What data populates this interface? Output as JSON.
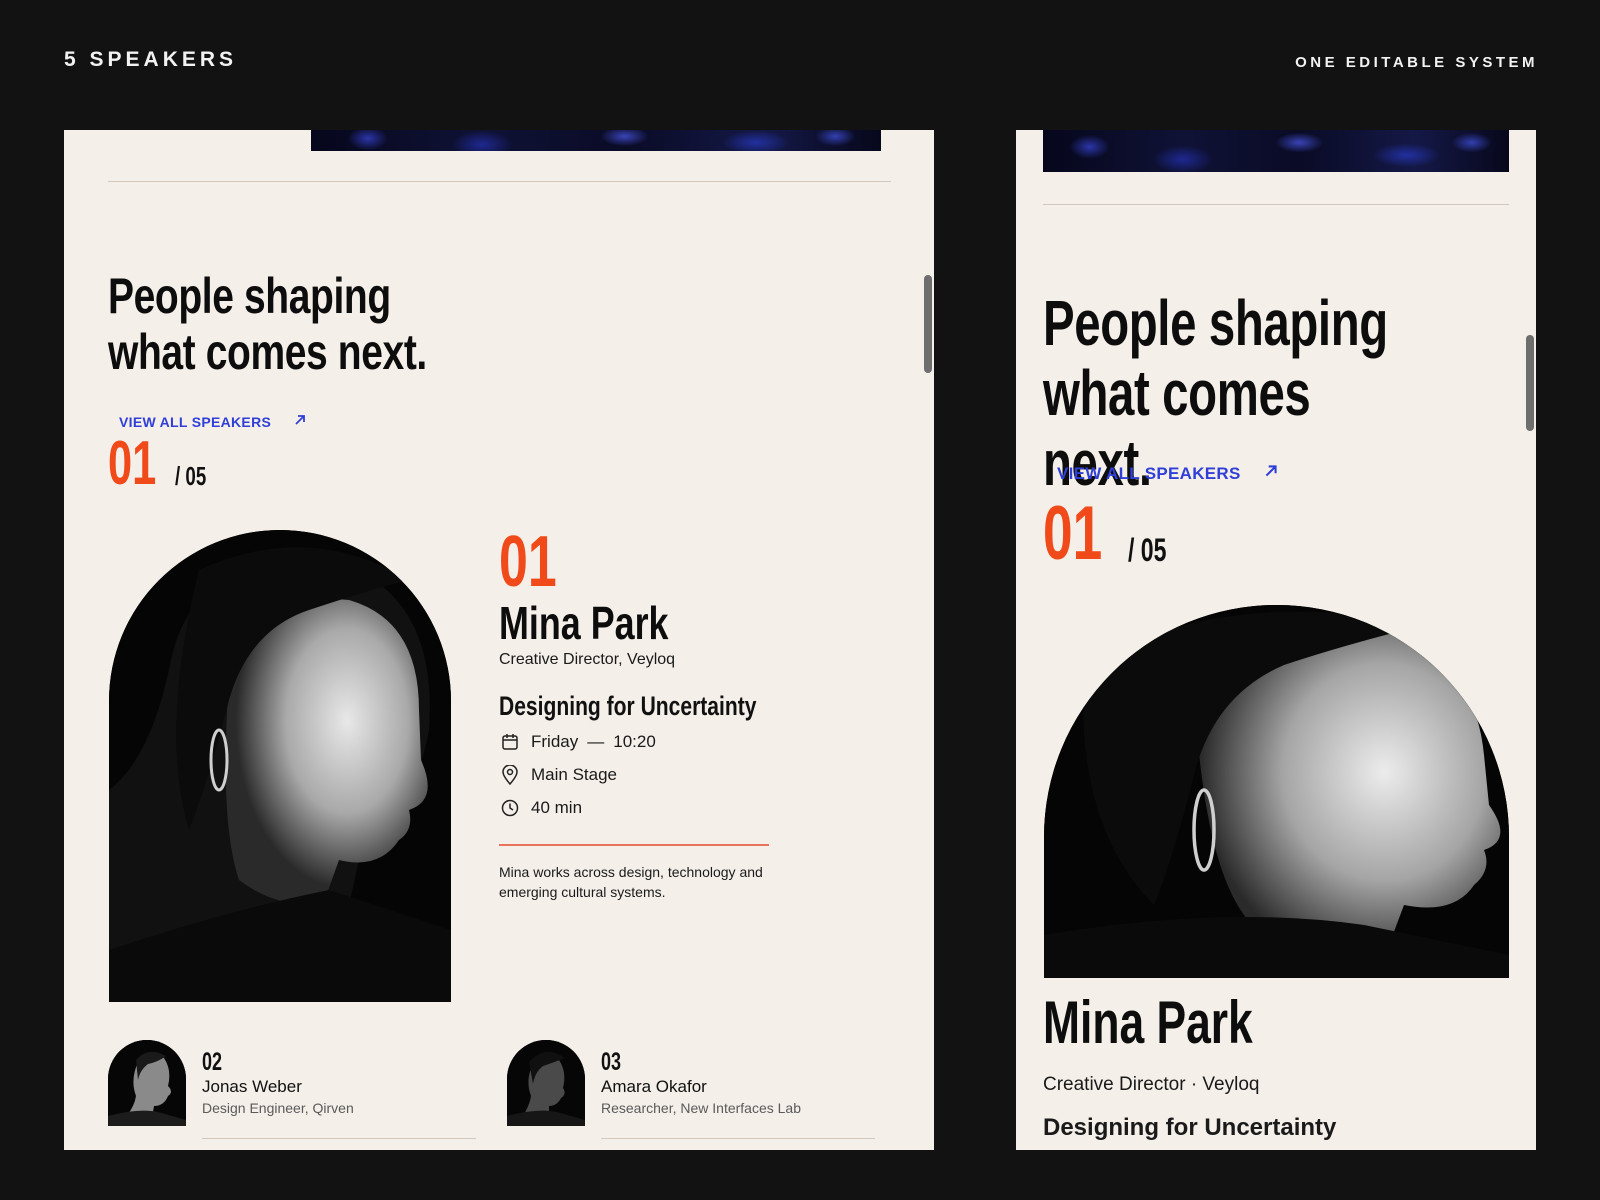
{
  "header": {
    "left_label": "5 SPEAKERS",
    "right_label": "ONE EDITABLE SYSTEM"
  },
  "section": {
    "headline": "People shaping\nwhat comes next.",
    "view_all_label": "VIEW ALL SPEAKERS",
    "view_all_icon": "arrow-up-right-icon",
    "accent_color": "#f04a1a",
    "link_color": "#2f3fd8"
  },
  "counter": {
    "current": "01",
    "total": "/ 05"
  },
  "featured": {
    "number": "01",
    "name": "Mina Park",
    "role": "Creative Director, Veyloq",
    "role_mobile": "Creative Director · Veyloq",
    "talk_title": "Designing for Uncertainty",
    "day": "Friday",
    "dash": "—",
    "time": "10:20",
    "location": "Main Stage",
    "duration": "40 min",
    "bio": "Mina works across design, technology and emerging cultural systems."
  },
  "speakers": [
    {
      "number": "02",
      "name": "Jonas Weber",
      "role": "Design Engineer, Qirven"
    },
    {
      "number": "03",
      "name": "Amara Okafor",
      "role": "Researcher, New Interfaces Lab"
    }
  ]
}
